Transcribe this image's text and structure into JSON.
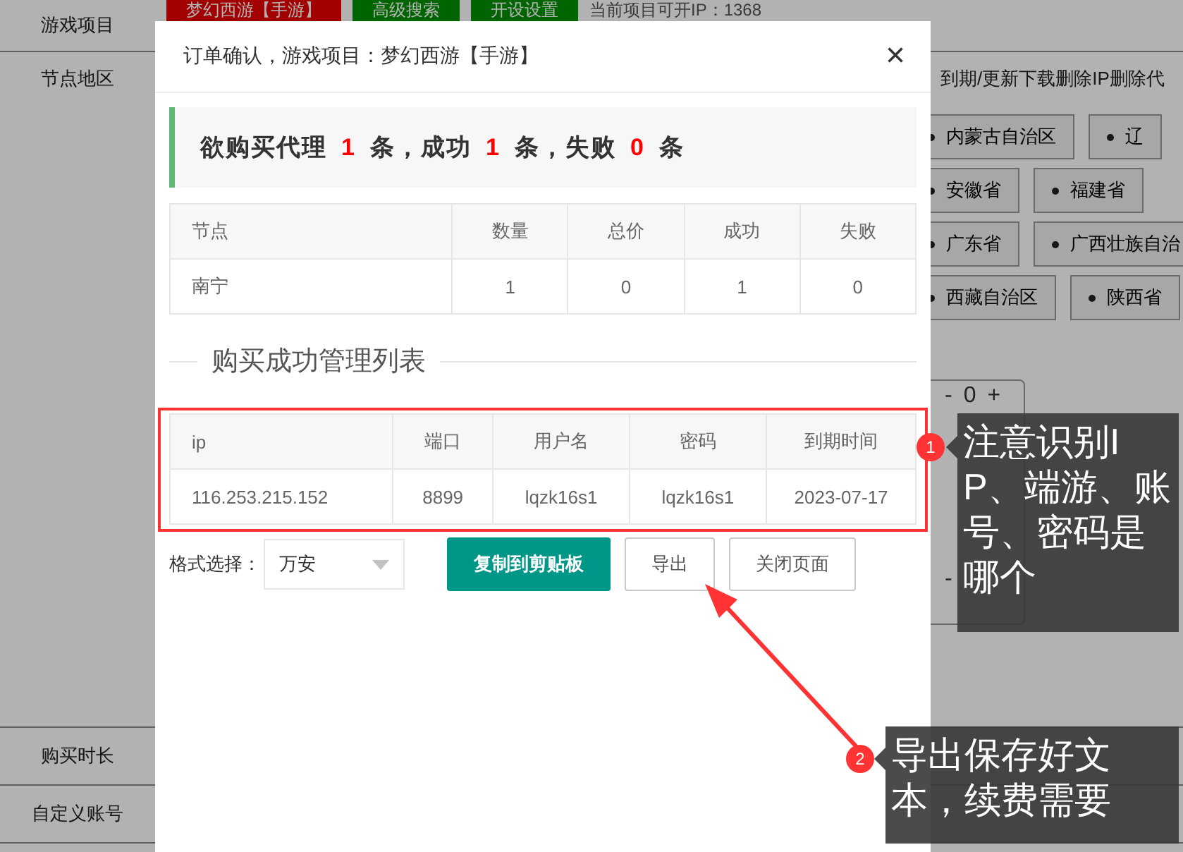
{
  "background": {
    "sidebar_labels": [
      "游戏项目",
      "节点地区",
      "购买时长",
      "自定义账号"
    ],
    "toolbar": {
      "buttons": [
        {
          "label": "梦幻西游【手游】",
          "kind": "danger"
        },
        {
          "label": "高级搜索",
          "kind": "success"
        },
        {
          "label": "开设设置",
          "kind": "success"
        }
      ],
      "ip_count": "当前项目可开IP：1368"
    },
    "notice": "到期/更新下载删除IP删除代",
    "regions": [
      [
        "内蒙古自治区",
        "辽"
      ],
      [
        "安徽省",
        "福建省"
      ],
      [
        "广东省",
        "广西壮族自治"
      ],
      [
        "西藏自治区",
        "陕西省"
      ]
    ],
    "steppers": [
      {
        "minus": "-",
        "value": "0",
        "plus": "+"
      },
      {
        "minus": "-"
      }
    ]
  },
  "dialog": {
    "title": "订单确认，游戏项目：梦幻西游【手游】",
    "close": "×",
    "summary": [
      {
        "text": "欲购买代理",
        "kind": "label"
      },
      {
        "text": "1",
        "kind": "count"
      },
      {
        "text": "条，成功",
        "kind": "label"
      },
      {
        "text": "1",
        "kind": "count"
      },
      {
        "text": "条，失败",
        "kind": "label"
      },
      {
        "text": "0",
        "kind": "count"
      },
      {
        "text": "条",
        "kind": "label"
      }
    ],
    "summary_table": {
      "columns": [
        "节点",
        "数量",
        "总价",
        "成功",
        "失败"
      ],
      "rows": [
        [
          "南宁",
          "1",
          "0",
          "1",
          "0"
        ]
      ]
    },
    "section_title": "购买成功管理列表",
    "result_table": {
      "columns": [
        "ip",
        "端口",
        "用户名",
        "密码",
        "到期时间"
      ],
      "rows": [
        [
          "116.253.215.152",
          "8899",
          "lqzk16s1",
          "lqzk16s1",
          "2023-07-17"
        ]
      ]
    },
    "format_label": "格式选择：",
    "format_select": {
      "value": "万安"
    },
    "buttons": [
      {
        "label": "复制到剪贴板",
        "kind": "primary"
      },
      {
        "label": "导出",
        "kind": "default"
      },
      {
        "label": "关闭页面",
        "kind": "default"
      }
    ]
  },
  "annotations": [
    {
      "number": "1",
      "text": "注意识别IP、端游、账号、密码是哪个"
    },
    {
      "number": "2",
      "text": "导出保存好文本，续费需要"
    }
  ]
}
